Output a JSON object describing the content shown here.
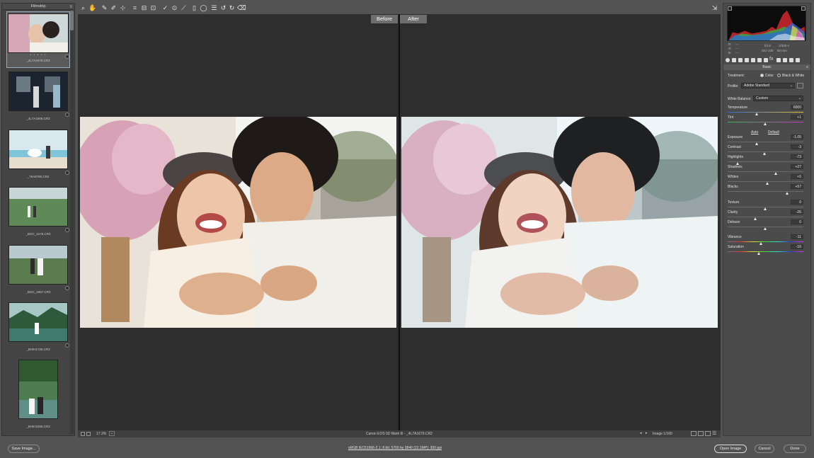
{
  "filmstrip": {
    "title": "Filmstrip",
    "items": [
      {
        "name": "_4L7A1679.CR2",
        "dots": "• • • • •",
        "selected": true
      },
      {
        "name": "_4L7A1606.CR2"
      },
      {
        "name": "_76A8785.CR2"
      },
      {
        "name": "_BOC_4176.CR2"
      },
      {
        "name": "_BOC_4357.CR2"
      },
      {
        "name": "_BHIH1726.CR2"
      },
      {
        "name": "_BHIH1555.CR2"
      }
    ]
  },
  "toolbar": {
    "tools": [
      "zoom-icon",
      "hand-icon",
      "white-balance-icon",
      "color-sampler-icon",
      "target-adjust-icon",
      "crop-icon",
      "straighten-icon",
      "transform-icon",
      "spot-removal-icon",
      "red-eye-icon",
      "adjustment-brush-icon",
      "graduated-filter-icon",
      "radial-filter-icon",
      "preferences-icon",
      "rotate-left-icon",
      "rotate-right-icon",
      "trash-icon"
    ]
  },
  "canvas": {
    "before_label": "Before",
    "after_label": "After"
  },
  "status": {
    "zoom": "17.3%",
    "camera_file": "Canon EOS 5D Mark III  -  _4L7A1679.CR2",
    "image_counter": "Image 1/160"
  },
  "histogram": {
    "r_label": "R:",
    "g_label": "G:",
    "b_label": "B:",
    "r_val": "---",
    "g_val": "---",
    "b_val": "---",
    "aperture": "f/2.8",
    "shutter": "1/320 s",
    "iso": "ISO 100",
    "focal": "50 mm"
  },
  "basic": {
    "header": "Basic",
    "treatment_label": "Treatment:",
    "treatment_color": "Color",
    "treatment_bw": "Black & White",
    "profile_label": "Profile:",
    "profile_value": "Adobe Standard",
    "wb_label": "White Balance:",
    "wb_value": "Custom",
    "auto_label": "Auto",
    "default_label": "Default",
    "sliders": [
      {
        "label": "Temperature",
        "value": "6000",
        "pos": 0.39
      },
      {
        "label": "Tint",
        "value": "+1",
        "pos": 0.5
      },
      {
        "label": "Exposure",
        "value": "-1.05",
        "pos": 0.39
      },
      {
        "label": "Contrast",
        "value": "-3",
        "pos": 0.49
      },
      {
        "label": "Highlights",
        "value": "-73",
        "pos": 0.14
      },
      {
        "label": "Shadows",
        "value": "+27",
        "pos": 0.64
      },
      {
        "label": "Whites",
        "value": "+5",
        "pos": 0.53
      },
      {
        "label": "Blacks",
        "value": "+57",
        "pos": 0.79
      },
      {
        "label": "Texture",
        "value": "0",
        "pos": 0.5
      },
      {
        "label": "Clarity",
        "value": "-26",
        "pos": 0.37
      },
      {
        "label": "Dehaze",
        "value": "0",
        "pos": 0.5
      },
      {
        "label": "Vibrance",
        "value": "-11",
        "pos": 0.44
      },
      {
        "label": "Saturation",
        "value": "-16",
        "pos": 0.42
      }
    ]
  },
  "bottom": {
    "save_label": "Save Image...",
    "workflow_link": "sRGB IEC61966-2.1; 8 bit; 5760 by 3840 (22.1MP); 300 ppi",
    "open_label": "Open Image",
    "cancel_label": "Cancel",
    "done_label": "Done"
  },
  "colors": {
    "accent": "#9ab0c8",
    "panel": "#4b4b4b",
    "canvas": "#2e2e2e"
  }
}
